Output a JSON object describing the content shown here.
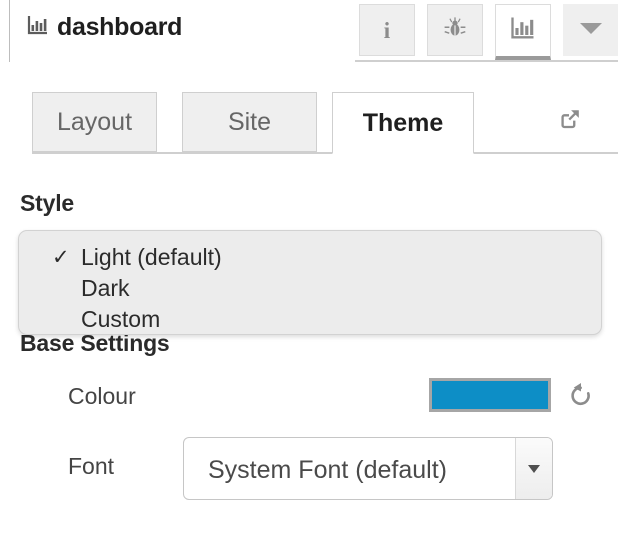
{
  "header": {
    "brand_title": "dashboard",
    "brand_logo_icon": "bar-chart-icon",
    "tools": [
      {
        "id": "info",
        "icon": "info-icon",
        "glyph": "i",
        "active": false
      },
      {
        "id": "bug",
        "icon": "bug-icon",
        "glyph": "",
        "active": false
      },
      {
        "id": "chart",
        "icon": "bar-chart-icon",
        "glyph": "",
        "active": true
      },
      {
        "id": "more",
        "icon": "chevron-down-icon",
        "glyph": "",
        "active": false
      }
    ]
  },
  "tabs": [
    {
      "id": "layout",
      "label": "Layout",
      "active": false
    },
    {
      "id": "site",
      "label": "Site",
      "active": false
    },
    {
      "id": "theme",
      "label": "Theme",
      "active": true
    }
  ],
  "tab_actions": {
    "external_link_icon": "external-link-icon"
  },
  "sections": {
    "style": {
      "heading": "Style",
      "menu_open": true,
      "options": [
        {
          "label": "Light (default)",
          "checked": true,
          "check_glyph": "✓"
        },
        {
          "label": "Dark",
          "checked": false,
          "check_glyph": ""
        },
        {
          "label": "Custom",
          "checked": false,
          "check_glyph": ""
        }
      ]
    },
    "base_settings": {
      "heading": "Base Settings",
      "colour": {
        "label": "Colour",
        "value": "#0d8ec6",
        "reset_icon": "reset-icon"
      },
      "font": {
        "label": "Font",
        "value": "System Font (default)",
        "caret_icon": "caret-down-icon"
      }
    }
  }
}
